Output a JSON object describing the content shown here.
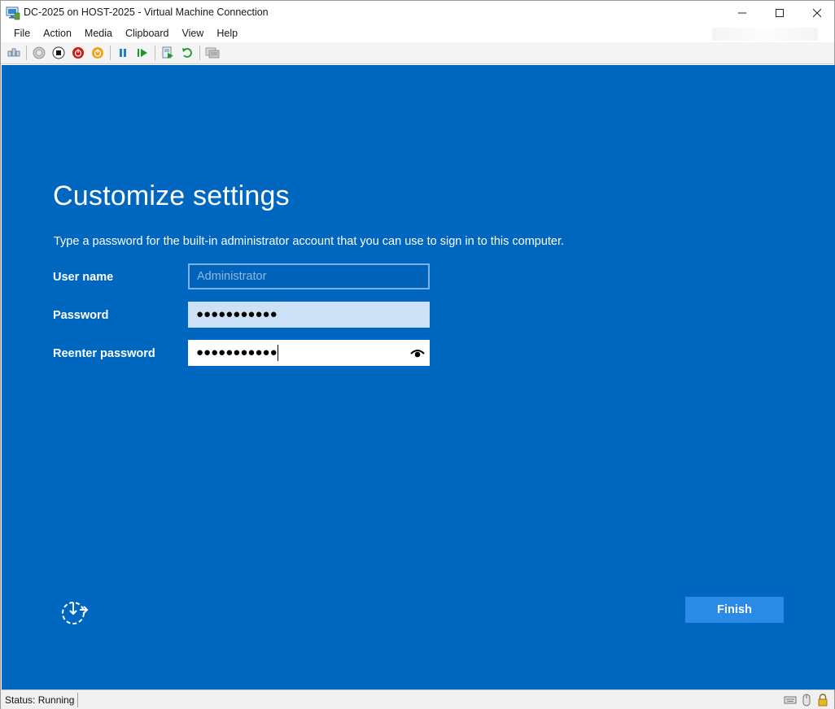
{
  "window": {
    "title": "DC-2025 on HOST-2025 - Virtual Machine Connection",
    "controls": {
      "minimize": "—",
      "maximize": "☐",
      "close": "✕"
    }
  },
  "menu": {
    "items": [
      "File",
      "Action",
      "Media",
      "Clipboard",
      "View",
      "Help"
    ]
  },
  "toolbar": {
    "buttons": [
      "ctrl-alt-del-icon",
      "start-icon",
      "turn-off-icon",
      "shut-down-icon",
      "save-icon",
      "pause-icon",
      "resume-icon",
      "checkpoint-icon",
      "revert-icon",
      "enhanced-session-icon"
    ]
  },
  "vm": {
    "heading": "Customize settings",
    "description": "Type a password for the built-in administrator account that you can use to sign in to this computer.",
    "fields": {
      "username": {
        "label": "User name",
        "value": "Administrator"
      },
      "password": {
        "label": "Password",
        "value": "●●●●●●●●●●●"
      },
      "reenter": {
        "label": "Reenter password",
        "value": "●●●●●●●●●●●"
      }
    },
    "finish_label": "Finish",
    "accent": "#0067c0",
    "button_color": "#2b8ae6"
  },
  "status": {
    "text": "Status: Running"
  }
}
